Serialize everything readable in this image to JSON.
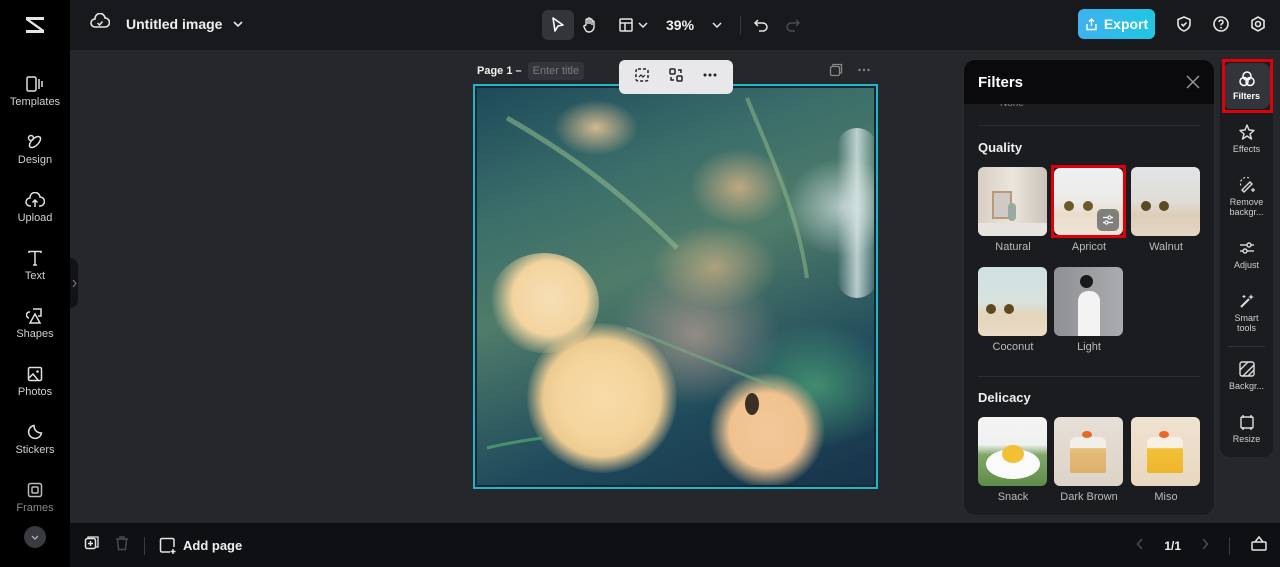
{
  "app": {
    "brand": "CapCut"
  },
  "header": {
    "title": "Untitled image",
    "zoom_level": "39%",
    "export_label": "Export"
  },
  "left_sidebar": {
    "items": [
      {
        "label": "Templates",
        "icon": "templates-icon"
      },
      {
        "label": "Design",
        "icon": "design-icon"
      },
      {
        "label": "Upload",
        "icon": "upload-icon"
      },
      {
        "label": "Text",
        "icon": "text-icon"
      },
      {
        "label": "Shapes",
        "icon": "shapes-icon"
      },
      {
        "label": "Photos",
        "icon": "photos-icon"
      },
      {
        "label": "Stickers",
        "icon": "stickers-icon"
      },
      {
        "label": "Frames",
        "icon": "frames-icon"
      }
    ]
  },
  "canvas": {
    "page_label": "Page 1 –",
    "title_placeholder": "Enter title"
  },
  "filters_panel": {
    "title": "Filters",
    "partial_item": "None",
    "sections": [
      {
        "name": "Quality",
        "items": [
          {
            "label": "Natural",
            "selected": false
          },
          {
            "label": "Apricot",
            "selected": true
          },
          {
            "label": "Walnut",
            "selected": false
          },
          {
            "label": "Coconut",
            "selected": false
          },
          {
            "label": "Light",
            "selected": false
          }
        ]
      },
      {
        "name": "Delicacy",
        "items": [
          {
            "label": "Snack",
            "selected": false
          },
          {
            "label": "Dark Brown",
            "selected": false
          },
          {
            "label": "Miso",
            "selected": false
          }
        ]
      }
    ]
  },
  "right_rail": {
    "items": [
      {
        "label": "Filters",
        "active": true
      },
      {
        "label": "Effects",
        "active": false
      },
      {
        "label": "Remove backgr...",
        "active": false
      },
      {
        "label": "Adjust",
        "active": false
      },
      {
        "label": "Smart tools",
        "active": false
      },
      {
        "label": "Backgr...",
        "active": false
      },
      {
        "label": "Resize",
        "active": false
      }
    ]
  },
  "footer": {
    "add_page_label": "Add page",
    "page_indicator": "1/1"
  },
  "colors": {
    "accent": "#1fc6e0",
    "selection_outline": "#e0000a",
    "canvas_border": "#1fb6cc"
  }
}
